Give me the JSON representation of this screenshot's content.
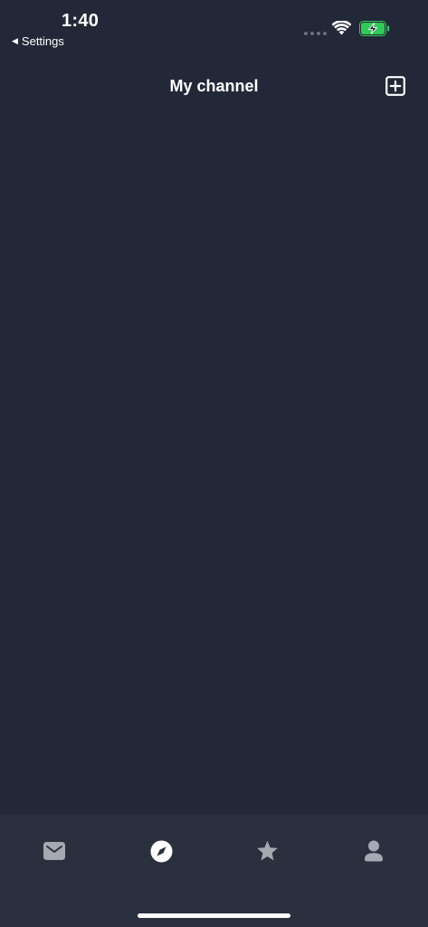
{
  "status_bar": {
    "time": "1:40",
    "back_label": "Settings",
    "battery_color": "#34c759"
  },
  "header": {
    "title": "My channel",
    "add_icon": "plus-square-icon"
  },
  "tab_bar": {
    "tabs": [
      {
        "icon": "envelope-icon",
        "active": false
      },
      {
        "icon": "compass-icon",
        "active": true
      },
      {
        "icon": "star-icon",
        "active": false
      },
      {
        "icon": "person-icon",
        "active": false
      }
    ],
    "active_color": "#ffffff",
    "inactive_color": "#a6a9b1"
  },
  "colors": {
    "background": "#222837",
    "tab_bar_background": "#2b303f"
  }
}
